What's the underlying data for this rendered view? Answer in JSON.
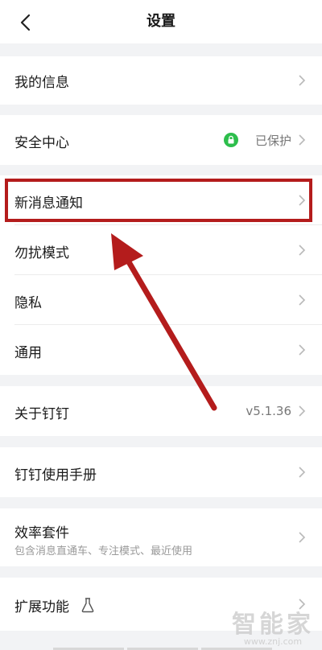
{
  "header": {
    "title": "设置",
    "back_icon": "chevron-left-icon"
  },
  "rows": {
    "my_info": "我的信息",
    "security": "安全中心",
    "security_status": "已保护",
    "new_message": "新消息通知",
    "dnd": "勿扰模式",
    "privacy": "隐私",
    "general": "通用",
    "about": "关于钉钉",
    "version": "v5.1.36",
    "manual": "钉钉使用手册",
    "suite": "效率套件",
    "suite_sub": "包含消息直通车、专注模式、最近使用",
    "extension": "扩展功能",
    "extension_icon": "flask-icon"
  },
  "colors": {
    "accent_green": "#2dbe4c",
    "highlight_red": "#b41c1c",
    "background": "#f2f3f5"
  },
  "watermark": {
    "title": "智能家",
    "url": "www.znj.com"
  }
}
